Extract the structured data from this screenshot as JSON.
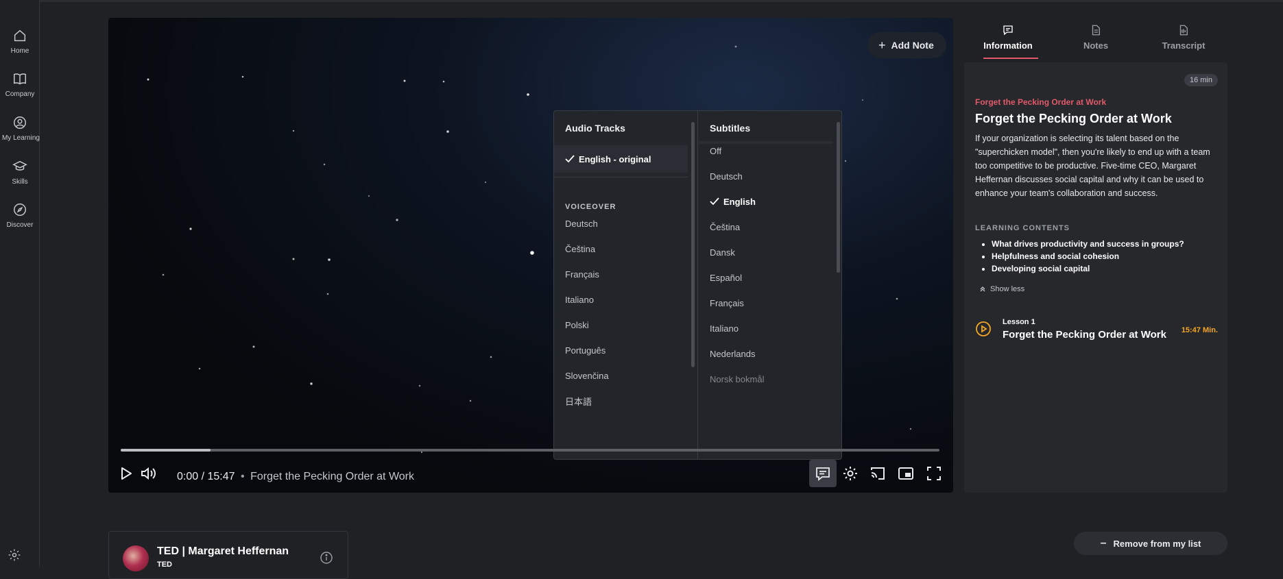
{
  "sidebar": {
    "items": [
      {
        "label": "Home",
        "icon": "home-icon"
      },
      {
        "label": "Company",
        "icon": "book-icon"
      },
      {
        "label": "My Learning",
        "icon": "user-circle-icon"
      },
      {
        "label": "Skills",
        "icon": "graduation-cap-icon"
      },
      {
        "label": "Discover",
        "icon": "compass-icon"
      }
    ]
  },
  "video": {
    "add_note": "Add Note",
    "current_time": "0:00",
    "separator": "/",
    "duration": "15:47",
    "title_sep": "•",
    "title": "Forget the Pecking Order at Work",
    "progress_buffered_fraction": 0.11
  },
  "menu": {
    "audio": {
      "title": "Audio Tracks",
      "selected": "English - original",
      "voiceover_label": "VOICEOVER",
      "voiceovers": [
        "Deutsch",
        "Čeština",
        "Français",
        "Italiano",
        "Polski",
        "Português",
        "Slovenčina",
        "日本語"
      ]
    },
    "subtitles": {
      "title": "Subtitles",
      "options": [
        "Off",
        "Deutsch",
        "English",
        "Čeština",
        "Dansk",
        "Español",
        "Français",
        "Italiano",
        "Nederlands",
        "Norsk bokmål"
      ],
      "selected": "English"
    }
  },
  "tabs": [
    {
      "label": "Information",
      "icon": "chat-icon",
      "active": true
    },
    {
      "label": "Notes",
      "icon": "document-icon",
      "active": false
    },
    {
      "label": "Transcript",
      "icon": "transcript-icon",
      "active": false
    }
  ],
  "info": {
    "duration_badge": "16 min",
    "kicker": "Forget the Pecking Order at Work",
    "title": "Forget the Pecking Order at Work",
    "description": "If your organization is selecting its talent based on the \"superchicken model\", then you're likely to end up with a team too competitive to be productive. Five-time CEO, Margaret Heffernan discusses social capital and why it can be used to enhance your team's collaboration and success.",
    "learning_contents_label": "LEARNING CONTENTS",
    "learning_contents": [
      "What drives productivity and success in groups?",
      "Helpfulness and social cohesion",
      "Developing social capital"
    ],
    "show_less": "Show less",
    "lesson": {
      "number": "Lesson 1",
      "title": "Forget the Pecking Order at Work",
      "duration": "15:47 Min."
    }
  },
  "author": {
    "name": "TED | Margaret Heffernan",
    "sub": "TED"
  },
  "actions": {
    "remove": "Remove from my list"
  },
  "colors": {
    "accent": "#e25a6a",
    "lesson_duration": "#f5a623",
    "background": "#202124",
    "panel": "#26282c"
  }
}
